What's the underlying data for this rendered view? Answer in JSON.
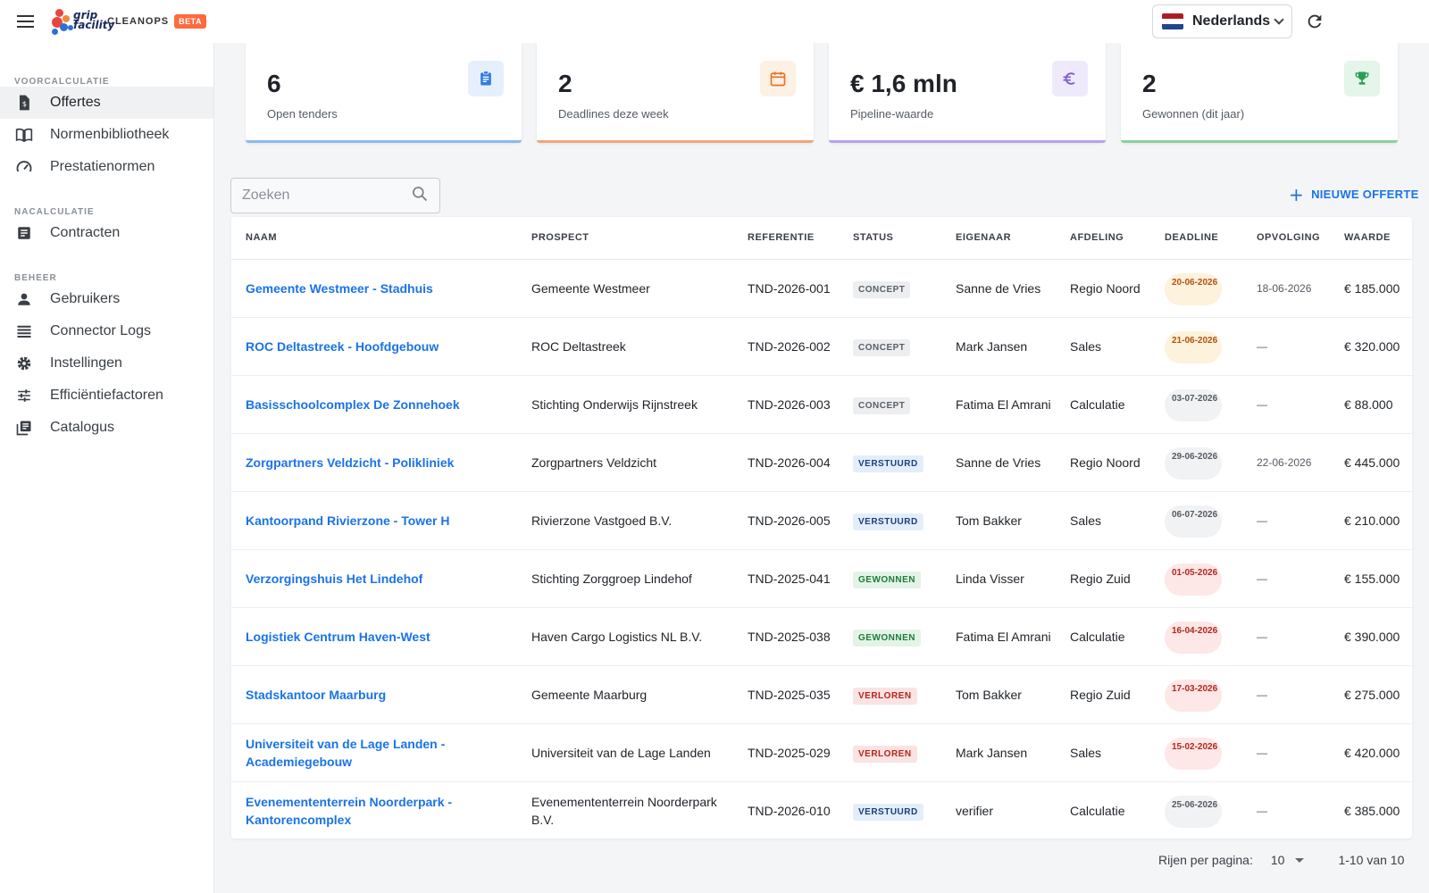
{
  "header": {
    "logo_text": "grip facility",
    "app_name": "CLEANOPS",
    "badge": "BETA",
    "language": "Nederlands"
  },
  "sidebar": {
    "sections": [
      {
        "title": "VOORCALCULATIE",
        "items": [
          {
            "label": "Offertes",
            "icon": "file-dollar-icon",
            "active": true
          },
          {
            "label": "Normenbibliotheek",
            "icon": "book-open-icon"
          },
          {
            "label": "Prestatienormen",
            "icon": "speedometer-icon"
          }
        ]
      },
      {
        "title": "NACALCULATIE",
        "items": [
          {
            "label": "Contracten",
            "icon": "document-icon"
          }
        ]
      },
      {
        "title": "BEHEER",
        "items": [
          {
            "label": "Gebruikers",
            "icon": "person-icon"
          },
          {
            "label": "Connector Logs",
            "icon": "list-icon"
          },
          {
            "label": "Instellingen",
            "icon": "gear-icon"
          },
          {
            "label": "Efficiëntiefactoren",
            "icon": "sliders-icon"
          },
          {
            "label": "Catalogus",
            "icon": "library-icon"
          }
        ]
      }
    ]
  },
  "cards": [
    {
      "value": "6",
      "label": "Open tenders",
      "icon": "clipboard-icon",
      "color": "#2f7de1",
      "bg": "#e6f0fd"
    },
    {
      "value": "2",
      "label": "Deadlines deze week",
      "icon": "calendar-icon",
      "color": "#e8731f",
      "bg": "#fdf0e4"
    },
    {
      "value": "€ 1,6 mln",
      "label": "Pipeline-waarde",
      "icon": "euro-icon",
      "color": "#7c5ad6",
      "bg": "#efeafb"
    },
    {
      "value": "2",
      "label": "Gewonnen (dit jaar)",
      "icon": "trophy-icon",
      "color": "#2a9d55",
      "bg": "#e4f5ea"
    }
  ],
  "search": {
    "placeholder": "Zoeken"
  },
  "new_button": "NIEUWE OFFERTE",
  "table": {
    "columns": [
      "NAAM",
      "PROSPECT",
      "REFERENTIE",
      "STATUS",
      "EIGENAAR",
      "AFDELING",
      "DEADLINE",
      "OPVOLGING",
      "WAARDE"
    ],
    "rows": [
      {
        "name": "Gemeente Westmeer - Stadhuis",
        "prospect": "Gemeente Westmeer",
        "ref": "TND-2026-001",
        "status": "CONCEPT",
        "owner": "Sanne de Vries",
        "dept": "Regio Noord",
        "deadline": "20-06-2026",
        "deadline_state": "warn",
        "follow": "18-06-2026",
        "value": "€ 185.000"
      },
      {
        "name": "ROC Deltastreek - Hoofdgebouw",
        "prospect": "ROC Deltastreek",
        "ref": "TND-2026-002",
        "status": "CONCEPT",
        "owner": "Mark Jansen",
        "dept": "Sales",
        "deadline": "21-06-2026",
        "deadline_state": "warn",
        "follow": "—",
        "value": "€ 320.000"
      },
      {
        "name": "Basisschoolcomplex De Zonnehoek",
        "prospect": "Stichting Onderwijs Rijnstreek",
        "ref": "TND-2026-003",
        "status": "CONCEPT",
        "owner": "Fatima El Amrani",
        "dept": "Calculatie",
        "deadline": "03-07-2026",
        "deadline_state": "neutral",
        "follow": "—",
        "value": "€ 88.000"
      },
      {
        "name": "Zorgpartners Veldzicht - Polikliniek",
        "prospect": "Zorgpartners Veldzicht",
        "ref": "TND-2026-004",
        "status": "VERSTUURD",
        "owner": "Sanne de Vries",
        "dept": "Regio Noord",
        "deadline": "29-06-2026",
        "deadline_state": "neutral",
        "follow": "22-06-2026",
        "value": "€ 445.000"
      },
      {
        "name": "Kantoorpand Rivierzone - Tower H",
        "prospect": "Rivierzone Vastgoed B.V.",
        "ref": "TND-2026-005",
        "status": "VERSTUURD",
        "owner": "Tom Bakker",
        "dept": "Sales",
        "deadline": "06-07-2026",
        "deadline_state": "neutral",
        "follow": "—",
        "value": "€ 210.000"
      },
      {
        "name": "Verzorgingshuis Het Lindehof",
        "prospect": "Stichting Zorggroep Lindehof",
        "ref": "TND-2025-041",
        "status": "GEWONNEN",
        "owner": "Linda Visser",
        "dept": "Regio Zuid",
        "deadline": "01-05-2026",
        "deadline_state": "overdue",
        "follow": "—",
        "value": "€ 155.000"
      },
      {
        "name": "Logistiek Centrum Haven-West",
        "prospect": "Haven Cargo Logistics NL B.V.",
        "ref": "TND-2025-038",
        "status": "GEWONNEN",
        "owner": "Fatima El Amrani",
        "dept": "Calculatie",
        "deadline": "16-04-2026",
        "deadline_state": "overdue",
        "follow": "—",
        "value": "€ 390.000"
      },
      {
        "name": "Stadskantoor Maarburg",
        "prospect": "Gemeente Maarburg",
        "ref": "TND-2025-035",
        "status": "VERLOREN",
        "owner": "Tom Bakker",
        "dept": "Regio Zuid",
        "deadline": "17-03-2026",
        "deadline_state": "overdue",
        "follow": "—",
        "value": "€ 275.000"
      },
      {
        "name": "Universiteit van de Lage Landen - Academiegebouw",
        "prospect": "Universiteit van de Lage Landen",
        "ref": "TND-2025-029",
        "status": "VERLOREN",
        "owner": "Mark Jansen",
        "dept": "Sales",
        "deadline": "15-02-2026",
        "deadline_state": "overdue",
        "follow": "—",
        "value": "€ 420.000"
      },
      {
        "name": "Evenemententerrein Noorderpark - Kantorencomplex",
        "prospect": "Evenemententerrein Noorderpark B.V.",
        "ref": "TND-2026-010",
        "status": "VERSTUURD",
        "owner": "verifier",
        "dept": "Calculatie",
        "deadline": "25-06-2026",
        "deadline_state": "neutral",
        "follow": "—",
        "value": "€ 385.000"
      }
    ]
  },
  "pagination": {
    "rows_label": "Rijen per pagina:",
    "rows_value": "10",
    "range": "1-10 van 10"
  }
}
